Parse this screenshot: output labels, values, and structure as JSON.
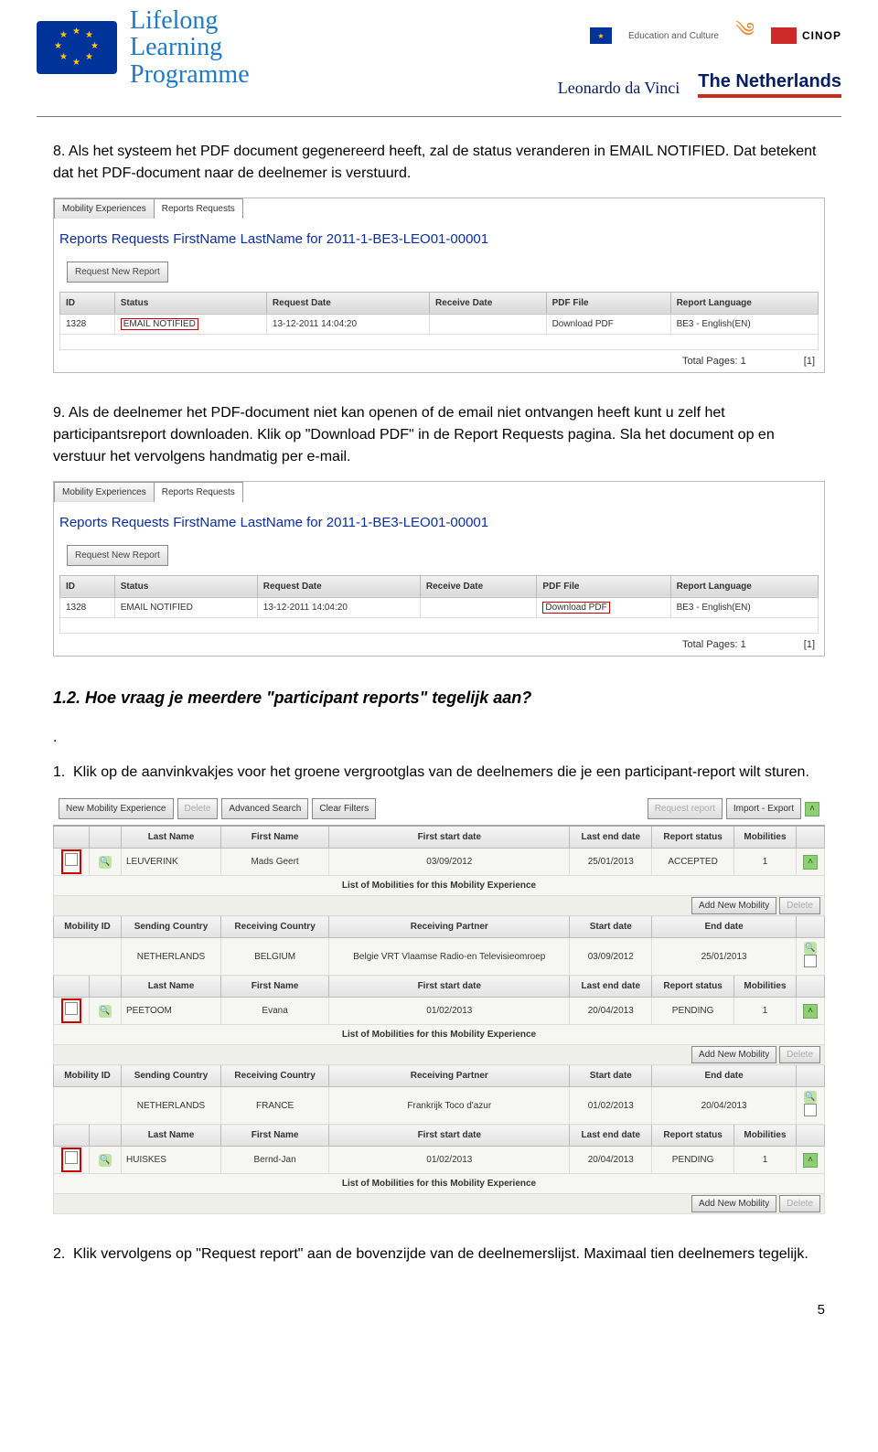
{
  "header": {
    "llp_l1": "Lifelong",
    "llp_l2": "Learning",
    "llp_l3": "Programme",
    "ec_text": "Education and Culture",
    "cinop": "CINOP",
    "leonardo": "Leonardo da Vinci",
    "netherlands": "The Netherlands"
  },
  "para8": "8. Als het systeem het PDF document gegenereerd heeft, zal de status veranderen in EMAIL NOTIFIED. Dat betekent dat het PDF-document naar de deelnemer is verstuurd.",
  "para9": "9. Als de deelnemer het PDF-document niet kan openen of de email niet ontvangen heeft kunt u zelf het participantsreport downloaden. Klik op \"Download PDF\" in de Report Requests pagina. Sla het document op en verstuur het vervolgens handmatig per e-mail.",
  "section12": "1.2. Hoe vraag je meerdere \"participant reports\" tegelijk aan?",
  "dot": ".",
  "li1": "Klik op de aanvinkvakjes voor het groene vergrootglas van de deelnemers die je een participant-report wilt sturen.",
  "li2": "Klik vervolgens op \"Request report\" aan de bovenzijde van de deelnemerslijst. Maximaal tien deelnemers tegelijk.",
  "tabs": {
    "mob": "Mobility Experiences",
    "req": "Reports Requests"
  },
  "report_heading": "Reports Requests FirstName LastName for 2011-1-BE3-LEO01-00001",
  "request_new": "Request New Report",
  "cols": {
    "id": "ID",
    "status": "Status",
    "reqdate": "Request Date",
    "recvdate": "Receive Date",
    "pdf": "PDF File",
    "lang": "Report Language"
  },
  "row": {
    "id": "1328",
    "status": "EMAIL NOTIFIED",
    "reqdate": "13-12-2011 14:04:20",
    "pdf": "Download PDF",
    "lang": "BE3 - English(EN)"
  },
  "total_pages": "Total Pages: 1",
  "page_link": "[1]",
  "toolbar": {
    "new_mob": "New Mobility Experience",
    "delete": "Delete",
    "adv": "Advanced Search",
    "clear": "Clear Filters",
    "req_report": "Request report",
    "import": "Import - Export"
  },
  "cols3": {
    "last": "Last Name",
    "first": "First Name",
    "fstart": "First start date",
    "lend": "Last end date",
    "rstatus": "Report status",
    "mob": "Mobilities"
  },
  "sub1": "List of Mobilities for this Mobility Experience",
  "cols3b": {
    "mid": "Mobility ID",
    "send": "Sending Country",
    "recvc": "Receiving Country",
    "recvp": "Receiving Partner",
    "sdate": "Start date",
    "edate": "End date"
  },
  "add_mob": "Add New Mobility",
  "r1": {
    "last": "LEUVERINK",
    "first": "Mads Geert",
    "fs": "03/09/2012",
    "le": "25/01/2013",
    "rs": "ACCEPTED",
    "m": "1"
  },
  "m1": {
    "send": "NETHERLANDS",
    "recvc": "BELGIUM",
    "recvp": "Belgie VRT Vlaamse Radio-en Televisieomroep",
    "sd": "03/09/2012",
    "ed": "25/01/2013"
  },
  "r2": {
    "last": "PEETOOM",
    "first": "Evana",
    "fs": "01/02/2013",
    "le": "20/04/2013",
    "rs": "PENDING",
    "m": "1"
  },
  "m2": {
    "send": "NETHERLANDS",
    "recvc": "FRANCE",
    "recvp": "Frankrijk Toco d'azur",
    "sd": "01/02/2013",
    "ed": "20/04/2013"
  },
  "r3": {
    "last": "HUISKES",
    "first": "Bernd-Jan",
    "fs": "01/02/2013",
    "le": "20/04/2013",
    "rs": "PENDING",
    "m": "1"
  },
  "page": "5"
}
